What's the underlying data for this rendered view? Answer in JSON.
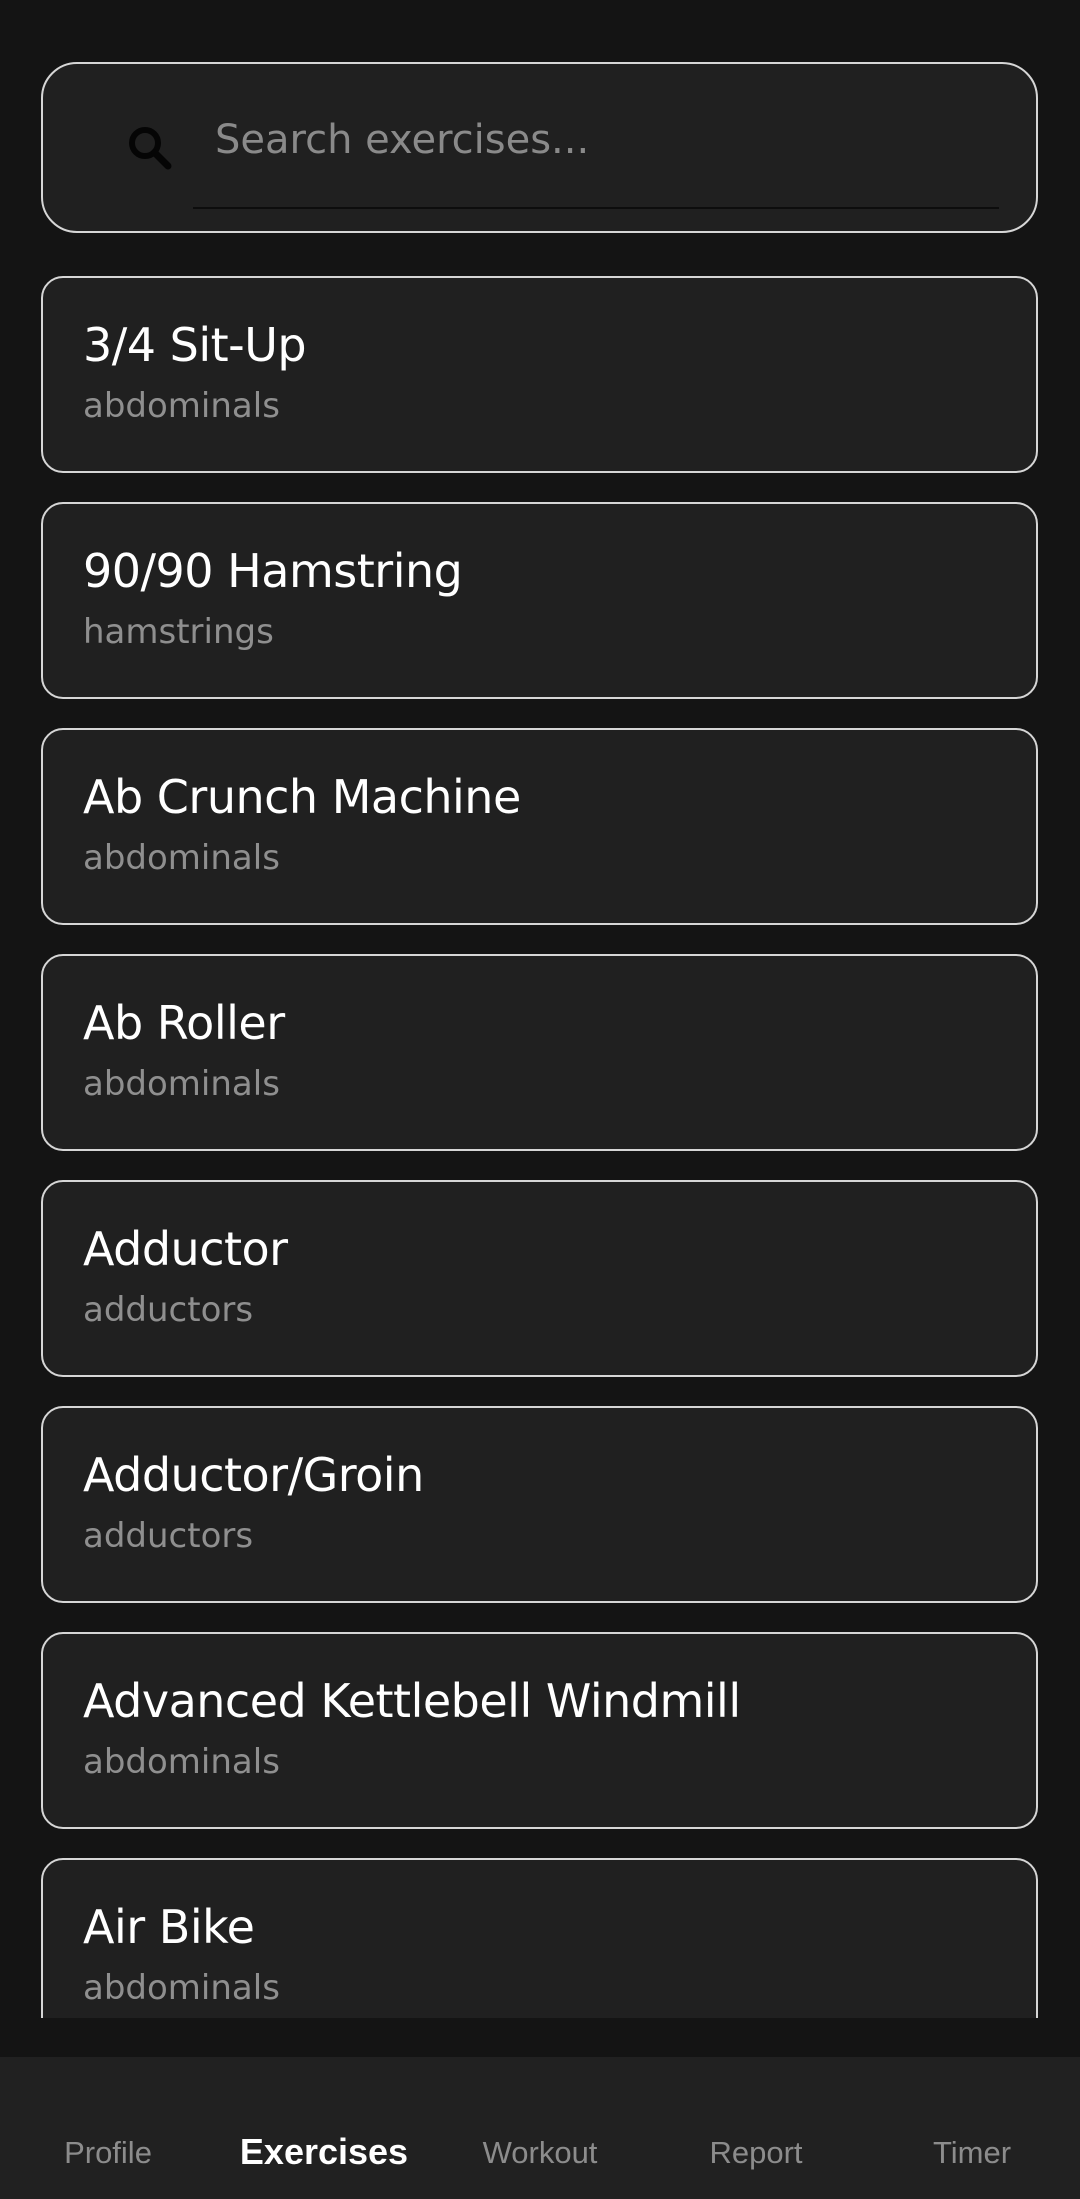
{
  "search": {
    "placeholder": "Search exercises...",
    "value": "",
    "icon": "search-icon"
  },
  "exercises": [
    {
      "name": "3/4 Sit-Up",
      "muscle": "abdominals"
    },
    {
      "name": "90/90 Hamstring",
      "muscle": "hamstrings"
    },
    {
      "name": "Ab Crunch Machine",
      "muscle": "abdominals"
    },
    {
      "name": "Ab Roller",
      "muscle": "abdominals"
    },
    {
      "name": "Adductor",
      "muscle": "adductors"
    },
    {
      "name": "Adductor/Groin",
      "muscle": "adductors"
    },
    {
      "name": "Advanced Kettlebell Windmill",
      "muscle": "abdominals"
    },
    {
      "name": "Air Bike",
      "muscle": "abdominals"
    }
  ],
  "nav": {
    "items": [
      {
        "label": "Profile",
        "active": false
      },
      {
        "label": "Exercises",
        "active": true
      },
      {
        "label": "Workout",
        "active": false
      },
      {
        "label": "Report",
        "active": false
      },
      {
        "label": "Timer",
        "active": false
      }
    ]
  },
  "colors": {
    "background": "#141414",
    "card": "#202020",
    "card_border": "#d6d6d6",
    "text_primary": "#ffffff",
    "text_secondary": "#8f8f8f",
    "nav_background": "#212121"
  }
}
